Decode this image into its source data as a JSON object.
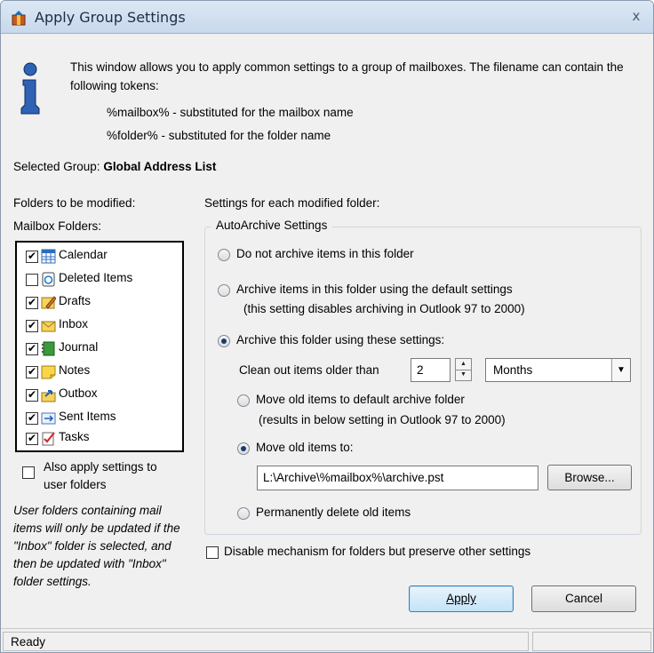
{
  "window": {
    "title": "Apply Group Settings",
    "close_label": "x"
  },
  "intro": {
    "text": "This window allows you to apply common settings to a group of mailboxes. The filename can contain the following tokens:",
    "token1": "%mailbox% - substituted for the mailbox name",
    "token2": "%folder% - substituted for the folder name"
  },
  "group": {
    "label": "Selected Group:",
    "value": "Global Address List"
  },
  "folders": {
    "section_label": "Folders to be modified:",
    "list_label": "Mailbox Folders:",
    "items": [
      {
        "label": "Calendar",
        "checked": true,
        "icon": "calendar-icon"
      },
      {
        "label": "Deleted Items",
        "checked": false,
        "icon": "deleted-items-icon"
      },
      {
        "label": "Drafts",
        "checked": true,
        "icon": "drafts-icon"
      },
      {
        "label": "Inbox",
        "checked": true,
        "icon": "inbox-icon"
      },
      {
        "label": "Journal",
        "checked": true,
        "icon": "journal-icon"
      },
      {
        "label": "Notes",
        "checked": true,
        "icon": "notes-icon"
      },
      {
        "label": "Outbox",
        "checked": true,
        "icon": "outbox-icon"
      },
      {
        "label": "Sent Items",
        "checked": true,
        "icon": "sent-items-icon"
      },
      {
        "label": "Tasks",
        "checked": true,
        "icon": "tasks-icon"
      }
    ],
    "apply_user_folders_line1": "Also apply settings to",
    "apply_user_folders_line2": "user folders",
    "apply_user_folders_checked": false,
    "note": "User folders containing mail items will only be updated if the \"Inbox\" folder is selected, and then be updated with \"Inbox\" folder settings."
  },
  "settings": {
    "section_label": "Settings for each modified folder:",
    "groupbox_title": "AutoArchive Settings",
    "option_no_archive": "Do not archive items in this folder",
    "option_default_line1": "Archive items in this folder using the default settings",
    "option_default_line2": "(this setting disables archiving in Outlook 97 to 2000)",
    "option_custom": "Archive this folder using these settings:",
    "selected_option": "custom",
    "clean_label": "Clean out items older than",
    "clean_value": "2",
    "clean_unit": "Months",
    "move_default_line1": "Move old items to default archive folder",
    "move_default_line2": "(results in below setting in Outlook 97 to 2000)",
    "move_to_label": "Move old items to:",
    "selected_move": "move_to",
    "path_value": "L:\\Archive\\%mailbox%\\archive.pst",
    "browse_label": "Browse...",
    "delete_label": "Permanently delete old items",
    "disable_label": "Disable mechanism for folders but preserve other settings",
    "disable_checked": false
  },
  "buttons": {
    "apply": "Apply",
    "cancel": "Cancel"
  },
  "status": {
    "text": "Ready"
  },
  "colors": {
    "titlebar": "#c8d9ec",
    "window_bg": "#f0f0f0",
    "default_button": "#c4e3f8",
    "radio_dot": "#1b3a73"
  }
}
